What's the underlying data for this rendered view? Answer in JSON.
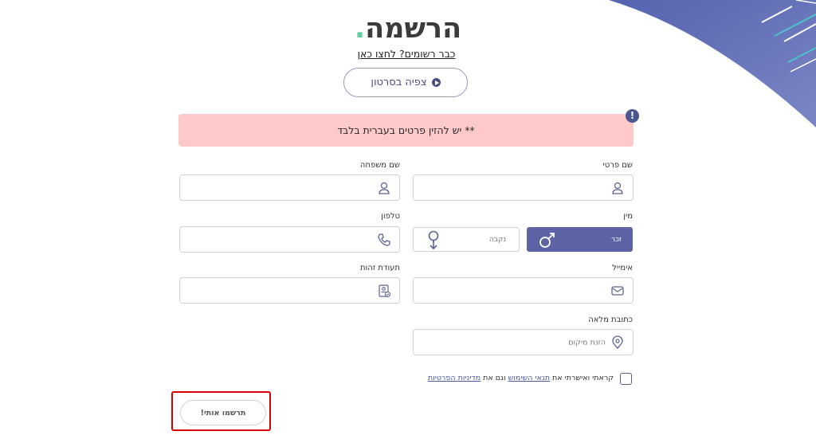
{
  "page": {
    "title": "הרשמה",
    "title_dot": ".",
    "login_link": "כבר רשומים? לחצו כאן",
    "video_button": "צפיה בסרטון",
    "alert_text": "** יש להזין פרטים בעברית בלבד",
    "alert_icon": "!"
  },
  "form": {
    "first_name": {
      "label": "שם פרטי",
      "value": ""
    },
    "last_name": {
      "label": "שם משפחה",
      "value": ""
    },
    "gender": {
      "label": "מין",
      "male": "זכר",
      "female": "נקבה",
      "selected": "זכר"
    },
    "phone": {
      "label": "טלפון",
      "value": ""
    },
    "email": {
      "label": "אימייל",
      "value": ""
    },
    "id_number": {
      "label": "תעודת זהות",
      "value": ""
    },
    "address": {
      "label": "כתובת מלאה",
      "placeholder": "הזנת מיקום"
    },
    "terms": {
      "prefix": "קראתי ואישרתי את",
      "terms_link": "תנאי השימוש",
      "middle": "וגם את",
      "privacy_link": "מדיניות הפרטיות",
      "checked": false
    },
    "submit_label": "תרשמו אותי!"
  },
  "colors": {
    "accent": "#5d64a5",
    "alert_bg": "#fdc9c9",
    "title_dot": "#5ccf9c",
    "highlight_frame": "#d80000"
  },
  "icons": [
    "play-icon",
    "alert-icon",
    "user-icon",
    "phone-icon",
    "male-icon",
    "female-icon",
    "mail-icon",
    "id-card-icon",
    "location-pin-icon"
  ]
}
